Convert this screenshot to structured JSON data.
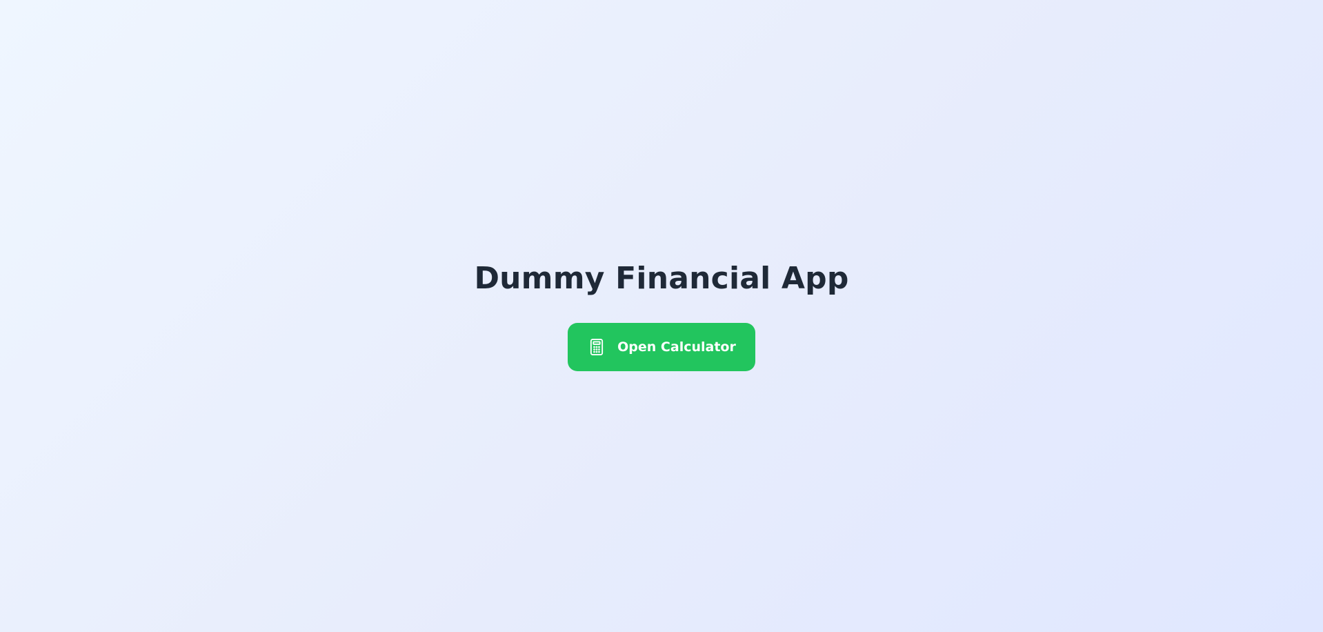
{
  "app": {
    "title": "Dummy Financial App"
  },
  "actions": {
    "open_calculator": {
      "label": "Open Calculator",
      "icon": "calculator-icon"
    }
  },
  "colors": {
    "background_start": "#eff6ff",
    "background_end": "#e0e7ff",
    "title": "#1f2937",
    "button": "#22c55e",
    "button_text": "#ffffff"
  }
}
